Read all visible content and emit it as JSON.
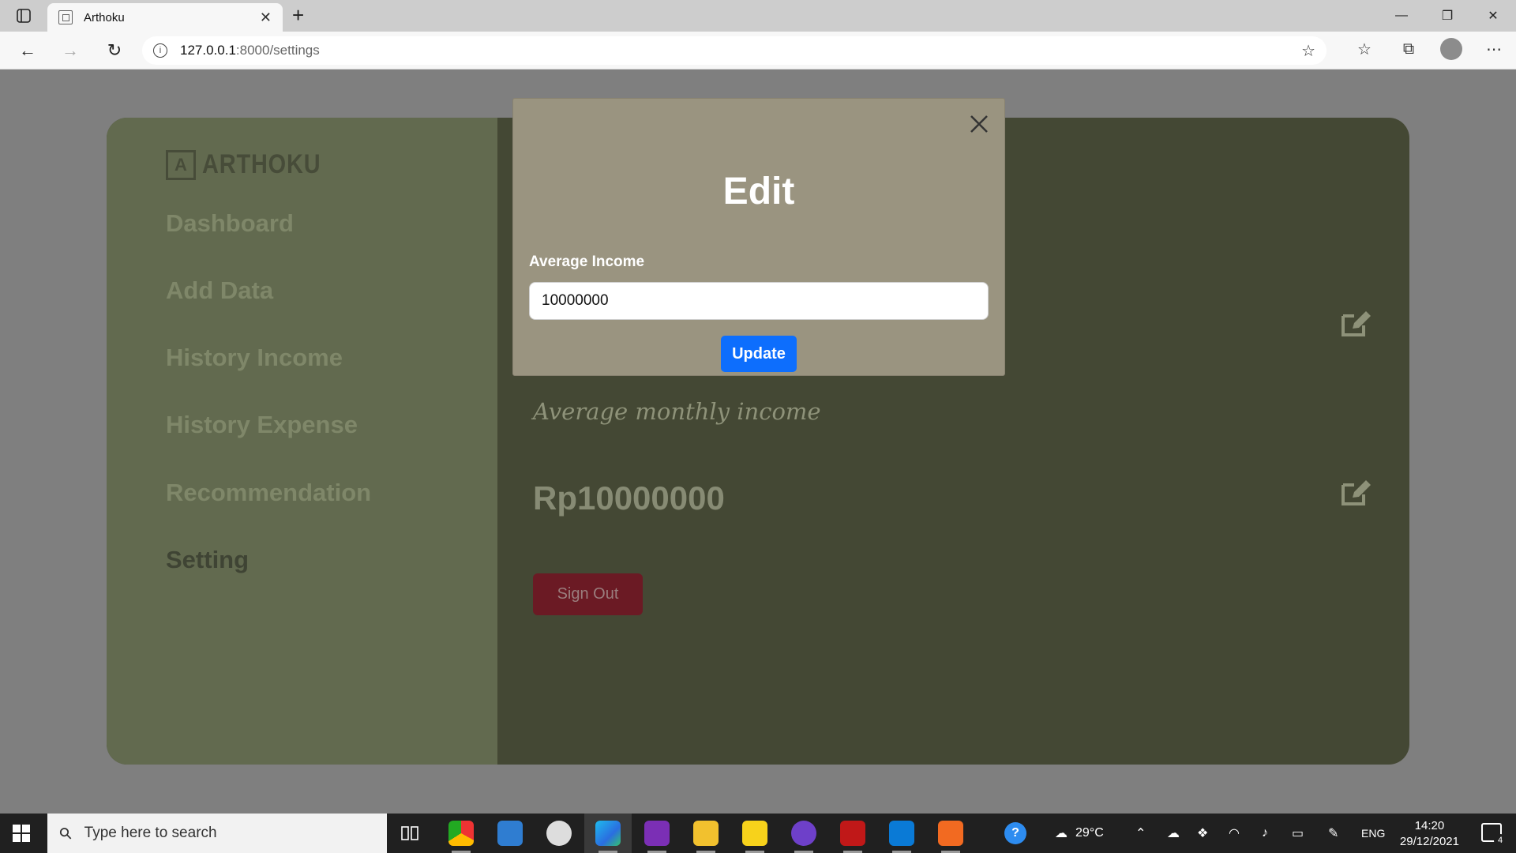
{
  "browser": {
    "tab_title": "Arthoku",
    "url_host": "127.0.0.1",
    "url_rest": ":8000/settings"
  },
  "app": {
    "logo_text": "ARTHOKU",
    "menu": [
      {
        "label": "Dashboard"
      },
      {
        "label": "Add Data"
      },
      {
        "label": "History Income"
      },
      {
        "label": "History Expense"
      },
      {
        "label": "Recommendation"
      },
      {
        "label": "Setting"
      }
    ],
    "average_label": "Average monthly income",
    "amount": "Rp10000000",
    "sign_out": "Sign Out"
  },
  "modal": {
    "title": "Edit",
    "field_label": "Average Income",
    "field_value": "10000000",
    "submit": "Update"
  },
  "taskbar": {
    "search_placeholder": "Type here to search",
    "weather": "29°C",
    "language": "ENG",
    "time": "14:20",
    "date": "29/12/2021",
    "notification_count": "4"
  },
  "colors": {
    "sidebar": "#626a4f",
    "content": "#444834",
    "modal": "#9a9480",
    "primary_button": "#0d6efd",
    "danger_button": "#6b1a24"
  }
}
